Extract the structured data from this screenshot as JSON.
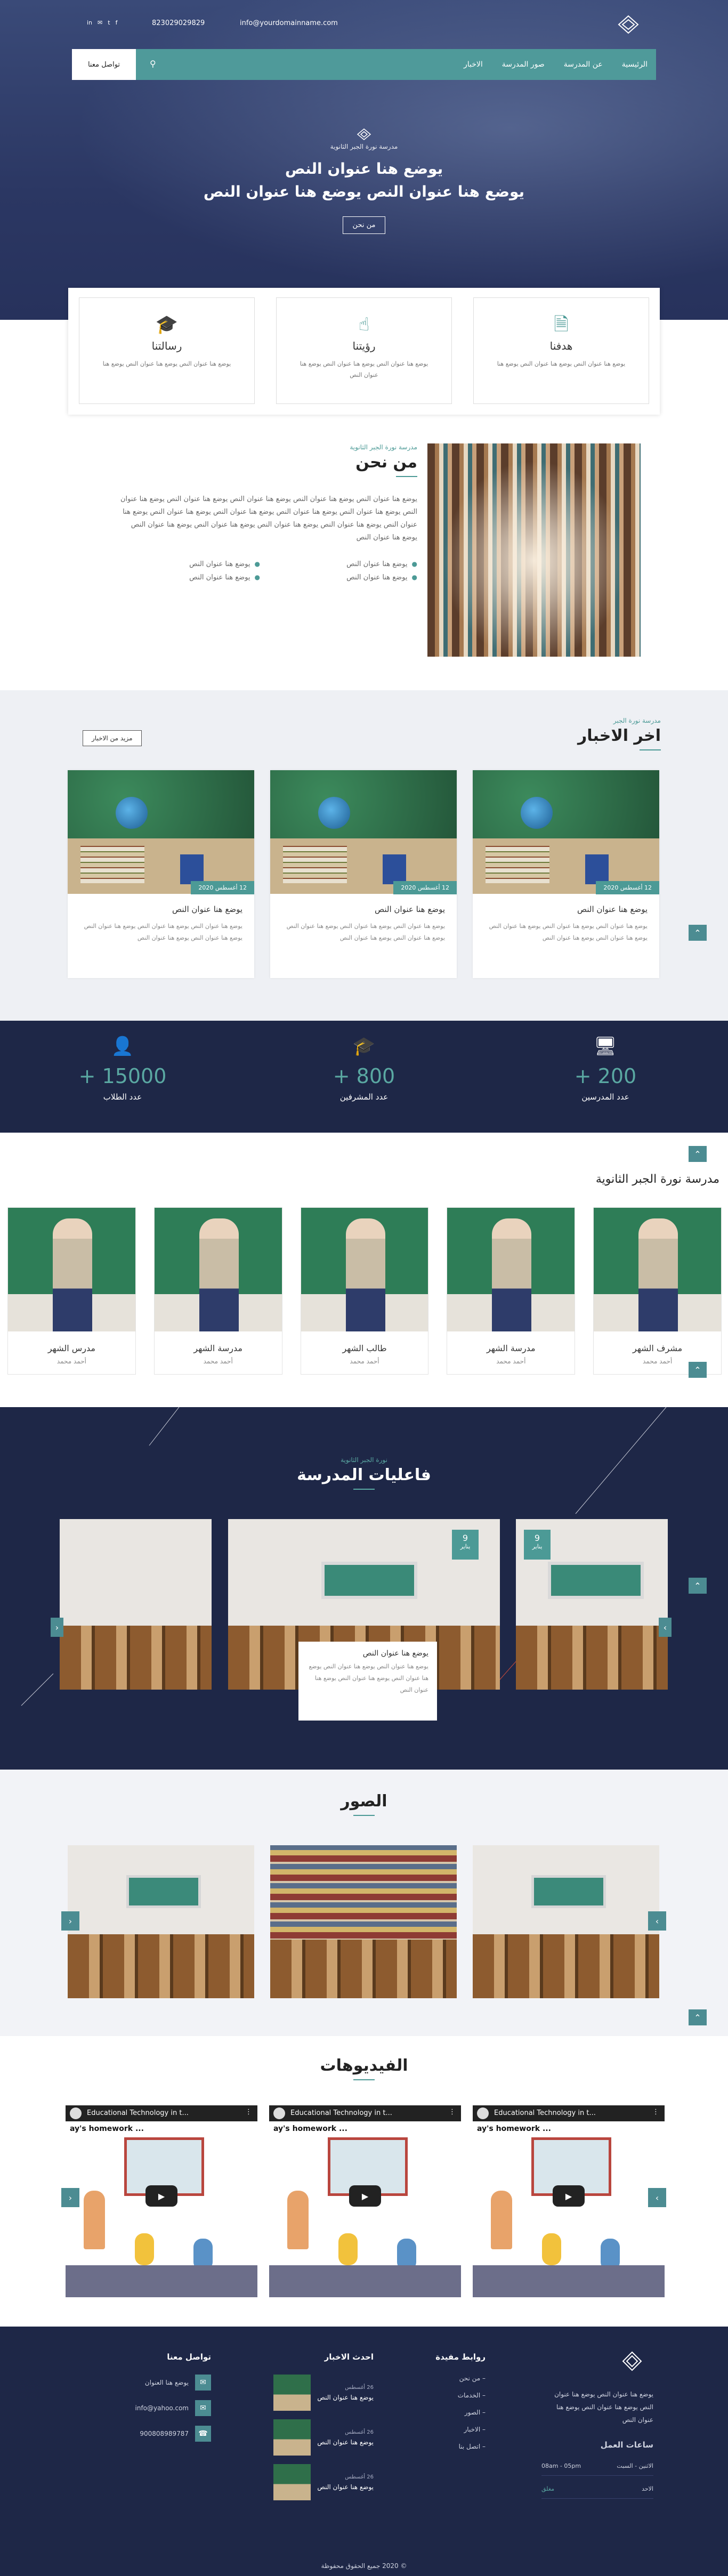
{
  "topbar": {
    "phone": "823029029829",
    "email": "info@yourdomainname.com",
    "social": [
      "in",
      "✉",
      "t",
      "f"
    ]
  },
  "nav": {
    "items": [
      "الرئيسية",
      "عن المدرسة",
      "صور المدرسة",
      "الاخبار"
    ],
    "contact_label": "تواصل معنا"
  },
  "hero": {
    "subtitle": "مدرسة نورة الجبر الثانوية",
    "title1": "يوضع هنا عنوان النص",
    "title2": "يوضع هنا عنوان النص يوضع هنا عنوان النص",
    "button": "من نحن"
  },
  "features": [
    {
      "icon": "document-icon",
      "title": "هدفنا",
      "text": "يوضع هنا عنوان النص يوضع هنا عنوان النص يوضع هنا"
    },
    {
      "icon": "touch-icon",
      "title": "رؤيتنا",
      "text": "يوضع هنا عنوان النص يوضع هنا عنوان النص يوضع هنا عنوان النص"
    },
    {
      "icon": "graduation-cap-icon",
      "title": "رسالتنا",
      "text": "يوضع هنا عنوان النص يوضع هنا عنوان النص يوضع هنا"
    }
  ],
  "about": {
    "subtitle": "مدرسة نورة الجبر الثانوية",
    "title": "من نحن",
    "body": "يوضع هنا عنوان النص يوضع هنا عنوان النص يوضع هنا عنوان النص يوضع هنا عنوان النص يوضع هنا عنوان النص يوضع هنا عنوان النص يوضع هنا عنوان النص يوضع هنا عنوان النص يوضع هنا عنوان النص يوضع هنا عنوان النص يوضع هنا عنوان النص يوضع هنا عنوان النص يوضع هنا عنوان النص يوضع هنا عنوان النص يوضع هنا عنوان النص",
    "list": [
      "يوضع هنا عنوان النص",
      "يوضع هنا عنوان النص",
      "يوضع هنا عنوان النص",
      "يوضع هنا عنوان النص"
    ]
  },
  "news": {
    "subtitle": "مدرسة نورة الجبر",
    "title": "اخر الاخبار",
    "more": "مزيد من الاخبار",
    "cards": [
      {
        "date": "12 أغسطس 2020",
        "title": "يوضع هنا عنوان النص",
        "text": "يوضع هنا عنوان النص يوضع هنا عنوان النص يوضع هنا عنوان النص يوضع هنا عنوان النص يوضع هنا عنوان النص"
      },
      {
        "date": "12 أغسطس 2020",
        "title": "يوضع هنا عنوان النص",
        "text": "يوضع هنا عنوان النص يوضع هنا عنوان النص يوضع هنا عنوان النص يوضع هنا عنوان النص يوضع هنا عنوان النص"
      },
      {
        "date": "12 أغسطس 2020",
        "title": "يوضع هنا عنوان النص",
        "text": "يوضع هنا عنوان النص يوضع هنا عنوان النص يوضع هنا عنوان النص يوضع هنا عنوان النص يوضع هنا عنوان النص"
      }
    ]
  },
  "stats": [
    {
      "icon": "teacher-board-icon",
      "number": "+ 200",
      "label": "عدد المدرسين"
    },
    {
      "icon": "graduation-cap-icon",
      "number": "+ 800",
      "label": "عدد المشرفين"
    },
    {
      "icon": "student-icon",
      "number": "+ 15000",
      "label": "عدد الطلاب"
    }
  ],
  "teachers": {
    "title": "مدرسة نورة الجبر الثانوية",
    "cards": [
      {
        "name": "مشرف الشهر",
        "role": "أحمد محمد"
      },
      {
        "name": "مدرسة الشهر",
        "role": "أحمد محمد"
      },
      {
        "name": "طالب الشهر",
        "role": "أحمد محمد"
      },
      {
        "name": "مدرسة الشهر",
        "role": "أحمد محمد"
      },
      {
        "name": "مدرس الشهر",
        "role": "أحمد محمد"
      }
    ]
  },
  "activities": {
    "subtitle": "نورة الجبر الثانوية",
    "title": "فاعليات المدرسة",
    "badge_day": "9",
    "badge_month": "يناير",
    "card_title": "يوضع هنا عنوان النص",
    "card_text": "يوضع هنا عنوان النص يوضع هنا عنوان النص يوضع هنا عنوان النص يوضع هنا عنوان النص يوضع هنا عنوان النص"
  },
  "photos": {
    "title": "الصور"
  },
  "videos": {
    "title": "الفيديوهات",
    "video_title": "Educational Technology in t...",
    "overlay_text": "ay's homework ..."
  },
  "footer": {
    "about": "يوضع هنا عنوان النص يوضع هنا عنوان النص يوضع هنا عنوان النص يوضع هنا عنوان النص",
    "hours_title": "ساعات العمل",
    "hours": [
      {
        "day": "الاثنين - السبت",
        "time": "08am - 05pm"
      },
      {
        "day": "الاحد",
        "time": "مغلق"
      }
    ],
    "links_title": "روابط مفيدة",
    "links": [
      "من نحن",
      "الخدمات",
      "الصور",
      "الاخبار",
      "اتصل بنا"
    ],
    "news_title": "احدث الاخبار",
    "news": [
      {
        "date": "26 أغسطس",
        "title": "يوضع هنا عنوان النص"
      },
      {
        "date": "26 أغسطس",
        "title": "يوضع هنا عنوان النص"
      },
      {
        "date": "26 أغسطس",
        "title": "يوضع هنا عنوان النص"
      }
    ],
    "contact_title": "تواصل معنا",
    "contact": [
      {
        "icon": "map-icon",
        "text": "يوضع هنا العنوان"
      },
      {
        "icon": "mail-icon",
        "text": "info@yahoo.com"
      },
      {
        "icon": "phone-icon",
        "text": "900808989787"
      }
    ],
    "copyright": "© 2020 جميع الحقوق محفوظة"
  }
}
